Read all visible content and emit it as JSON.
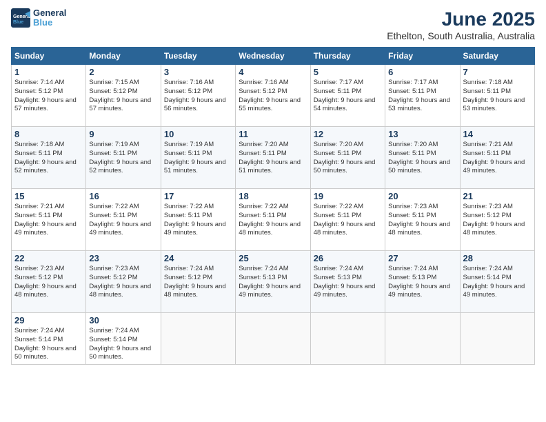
{
  "header": {
    "logo_line1": "General",
    "logo_line2": "Blue",
    "month": "June 2025",
    "location": "Ethelton, South Australia, Australia"
  },
  "weekdays": [
    "Sunday",
    "Monday",
    "Tuesday",
    "Wednesday",
    "Thursday",
    "Friday",
    "Saturday"
  ],
  "weeks": [
    [
      {
        "day": 1,
        "rise": "7:14 AM",
        "set": "5:12 PM",
        "daylight": "9 hours and 57 minutes."
      },
      {
        "day": 2,
        "rise": "7:15 AM",
        "set": "5:12 PM",
        "daylight": "9 hours and 57 minutes."
      },
      {
        "day": 3,
        "rise": "7:16 AM",
        "set": "5:12 PM",
        "daylight": "9 hours and 56 minutes."
      },
      {
        "day": 4,
        "rise": "7:16 AM",
        "set": "5:12 PM",
        "daylight": "9 hours and 55 minutes."
      },
      {
        "day": 5,
        "rise": "7:17 AM",
        "set": "5:11 PM",
        "daylight": "9 hours and 54 minutes."
      },
      {
        "day": 6,
        "rise": "7:17 AM",
        "set": "5:11 PM",
        "daylight": "9 hours and 53 minutes."
      },
      {
        "day": 7,
        "rise": "7:18 AM",
        "set": "5:11 PM",
        "daylight": "9 hours and 53 minutes."
      }
    ],
    [
      {
        "day": 8,
        "rise": "7:18 AM",
        "set": "5:11 PM",
        "daylight": "9 hours and 52 minutes."
      },
      {
        "day": 9,
        "rise": "7:19 AM",
        "set": "5:11 PM",
        "daylight": "9 hours and 52 minutes."
      },
      {
        "day": 10,
        "rise": "7:19 AM",
        "set": "5:11 PM",
        "daylight": "9 hours and 51 minutes."
      },
      {
        "day": 11,
        "rise": "7:20 AM",
        "set": "5:11 PM",
        "daylight": "9 hours and 51 minutes."
      },
      {
        "day": 12,
        "rise": "7:20 AM",
        "set": "5:11 PM",
        "daylight": "9 hours and 50 minutes."
      },
      {
        "day": 13,
        "rise": "7:20 AM",
        "set": "5:11 PM",
        "daylight": "9 hours and 50 minutes."
      },
      {
        "day": 14,
        "rise": "7:21 AM",
        "set": "5:11 PM",
        "daylight": "9 hours and 49 minutes."
      }
    ],
    [
      {
        "day": 15,
        "rise": "7:21 AM",
        "set": "5:11 PM",
        "daylight": "9 hours and 49 minutes."
      },
      {
        "day": 16,
        "rise": "7:22 AM",
        "set": "5:11 PM",
        "daylight": "9 hours and 49 minutes."
      },
      {
        "day": 17,
        "rise": "7:22 AM",
        "set": "5:11 PM",
        "daylight": "9 hours and 49 minutes."
      },
      {
        "day": 18,
        "rise": "7:22 AM",
        "set": "5:11 PM",
        "daylight": "9 hours and 48 minutes."
      },
      {
        "day": 19,
        "rise": "7:22 AM",
        "set": "5:11 PM",
        "daylight": "9 hours and 48 minutes."
      },
      {
        "day": 20,
        "rise": "7:23 AM",
        "set": "5:11 PM",
        "daylight": "9 hours and 48 minutes."
      },
      {
        "day": 21,
        "rise": "7:23 AM",
        "set": "5:12 PM",
        "daylight": "9 hours and 48 minutes."
      }
    ],
    [
      {
        "day": 22,
        "rise": "7:23 AM",
        "set": "5:12 PM",
        "daylight": "9 hours and 48 minutes."
      },
      {
        "day": 23,
        "rise": "7:23 AM",
        "set": "5:12 PM",
        "daylight": "9 hours and 48 minutes."
      },
      {
        "day": 24,
        "rise": "7:24 AM",
        "set": "5:12 PM",
        "daylight": "9 hours and 48 minutes."
      },
      {
        "day": 25,
        "rise": "7:24 AM",
        "set": "5:13 PM",
        "daylight": "9 hours and 49 minutes."
      },
      {
        "day": 26,
        "rise": "7:24 AM",
        "set": "5:13 PM",
        "daylight": "9 hours and 49 minutes."
      },
      {
        "day": 27,
        "rise": "7:24 AM",
        "set": "5:13 PM",
        "daylight": "9 hours and 49 minutes."
      },
      {
        "day": 28,
        "rise": "7:24 AM",
        "set": "5:14 PM",
        "daylight": "9 hours and 49 minutes."
      }
    ],
    [
      {
        "day": 29,
        "rise": "7:24 AM",
        "set": "5:14 PM",
        "daylight": "9 hours and 50 minutes."
      },
      {
        "day": 30,
        "rise": "7:24 AM",
        "set": "5:14 PM",
        "daylight": "9 hours and 50 minutes."
      },
      null,
      null,
      null,
      null,
      null
    ]
  ]
}
